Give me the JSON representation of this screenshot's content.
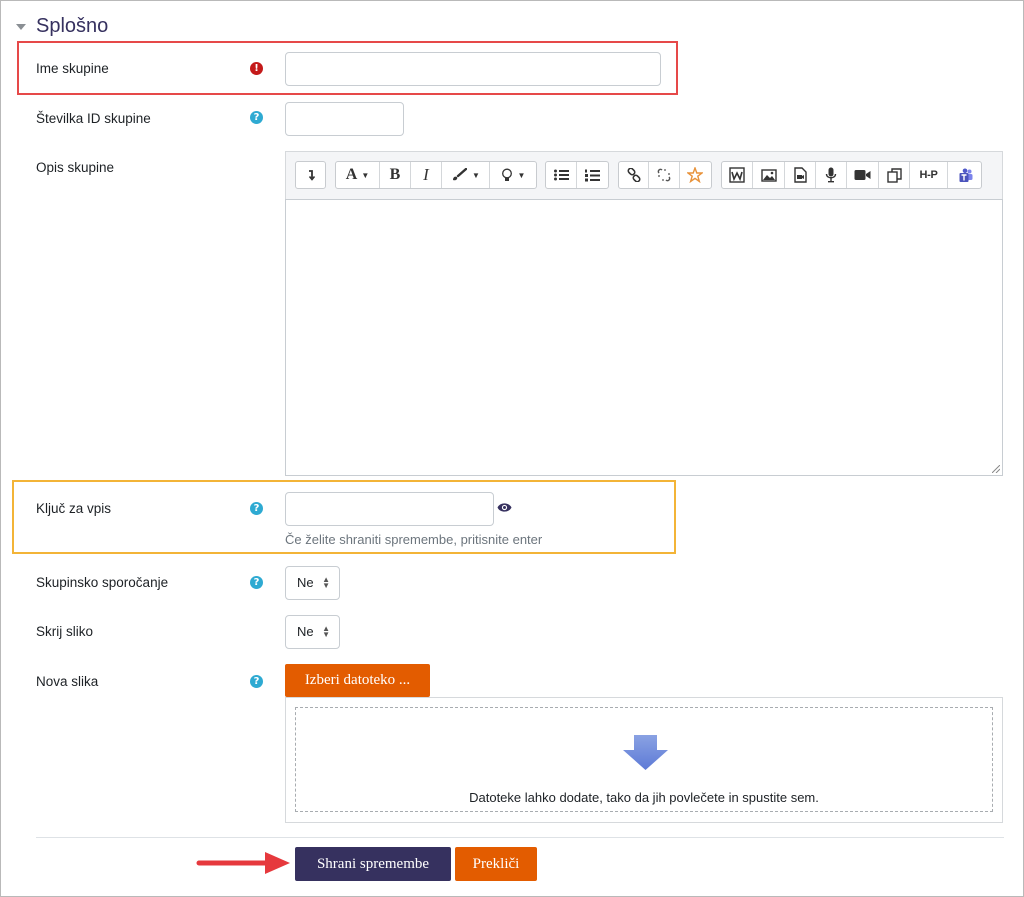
{
  "section": {
    "title": "Splošno"
  },
  "fields": {
    "group_name": {
      "label": "Ime skupine",
      "value": ""
    },
    "id_number": {
      "label": "Številka ID skupine",
      "value": ""
    },
    "description": {
      "label": "Opis skupine"
    },
    "enrolment_key": {
      "label": "Ključ za vpis",
      "value": "",
      "hint": "Če želite shraniti spremembe, pritisnite enter"
    },
    "group_messaging": {
      "label": "Skupinsko sporočanje",
      "selected": "Ne"
    },
    "hide_picture": {
      "label": "Skrij sliko",
      "selected": "Ne"
    },
    "new_picture": {
      "label": "Nova slika",
      "choose_button": "Izberi datoteko ...",
      "drop_text": "Datoteke lahko dodate, tako da jih povlečete in spustite sem."
    }
  },
  "icons": {
    "required": "!",
    "help": "?"
  },
  "editor_toolbar": {
    "text_buttons": {
      "font": "A",
      "bold": "B",
      "italic": "I",
      "h5p": "H-P"
    }
  },
  "buttons": {
    "save": "Shrani spremembe",
    "cancel": "Prekliči"
  },
  "colors": {
    "accent": "#36315f",
    "orange": "#e35c00",
    "required": "#c41a1a",
    "help": "#2eaad2",
    "highlight_red": "#e64949",
    "highlight_orange": "#f3b437",
    "arrow": "#e6393d"
  }
}
